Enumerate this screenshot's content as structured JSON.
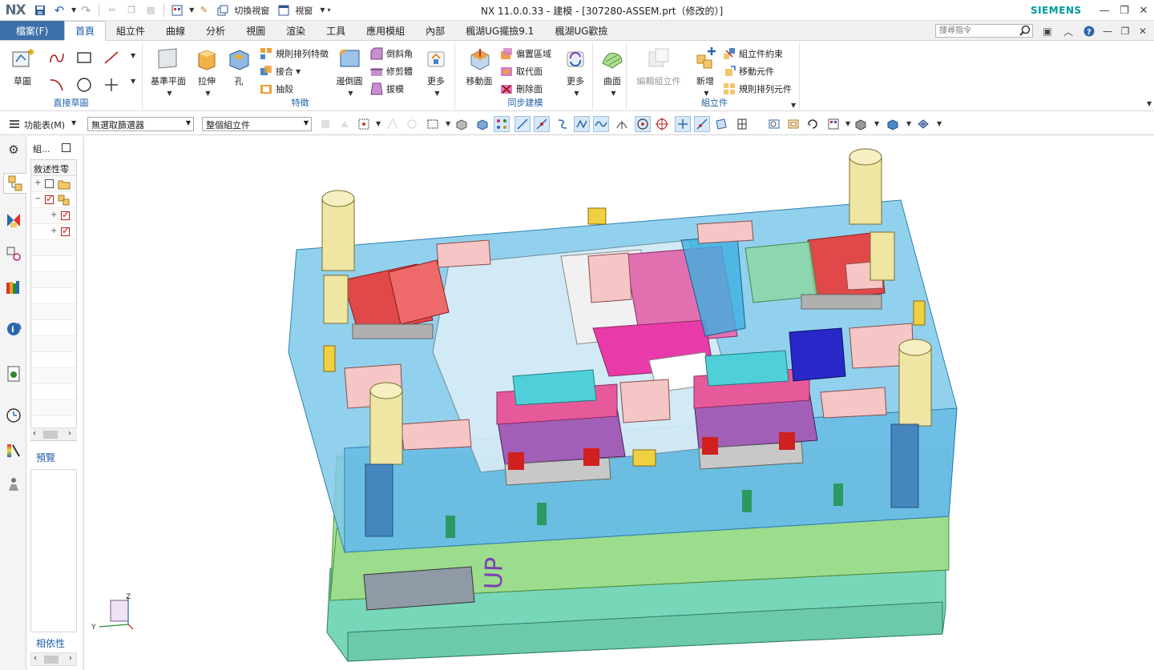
{
  "app": {
    "logo": "NX",
    "title": "NX 11.0.0.33 - 建模 - [307280-ASSEM.prt（修改的）]",
    "brand": "SIEMENS",
    "brand_color": "#009999",
    "accent_color": "#3d6fa8"
  },
  "quick_access": {
    "switch_window": "切換視窗",
    "window": "視窗"
  },
  "menu": {
    "file": "檔案(F)",
    "tabs": [
      "首頁",
      "組立件",
      "曲線",
      "分析",
      "視圖",
      "渲染",
      "工具",
      "應用模組",
      "內部",
      "楓湖UG擺撿9.1",
      "楓湖UG歡撿"
    ],
    "active_tab": "首頁",
    "search_placeholder": "搜尋指令"
  },
  "ribbon": {
    "direct_sketch": {
      "label": "直接草圖",
      "sketch": "草圖"
    },
    "feature": {
      "label": "特徵",
      "datum_plane": "基準平面",
      "extrude": "拉伸",
      "hole": "孔",
      "pattern_feature": "規則排列特徵",
      "unite": "接合",
      "shell": "抽殼",
      "edge_blend": "邊倒圓",
      "chamfer": "倒斜角",
      "trim_body": "修剪體",
      "draft": "拔模",
      "more": "更多"
    },
    "sync_modeling": {
      "label": "同步建模",
      "move_face": "移動面",
      "offset_region": "偏置區域",
      "replace_face": "取代面",
      "delete_face": "刪除面",
      "more": "更多"
    },
    "surface": {
      "label": "曲面"
    },
    "assembly": {
      "label": "組立件",
      "edit_component": "編輯組立件",
      "new": "新增",
      "constraints": "組立件約束",
      "move_component": "移動元件",
      "pattern_component": "規則排列元件"
    }
  },
  "command_bar": {
    "menu_label": "功能表(M)",
    "filter": "無選取篩選器",
    "scope": "整個組立件"
  },
  "navigator": {
    "header": "組...",
    "column": "敘述性零",
    "rows": [
      {
        "expand": "+",
        "checked": false,
        "icon": "folder-icon"
      },
      {
        "expand": "−",
        "checked": true,
        "icon": "assembly-icon"
      },
      {
        "expand": "+",
        "checked": true,
        "icon": ""
      },
      {
        "expand": "+",
        "checked": true,
        "icon": ""
      }
    ],
    "preview": "預覽",
    "dependencies": "相依性"
  },
  "viewport": {
    "triad": {
      "x": "X",
      "y": "Y",
      "z": "Z"
    },
    "plate_text": "UP"
  }
}
